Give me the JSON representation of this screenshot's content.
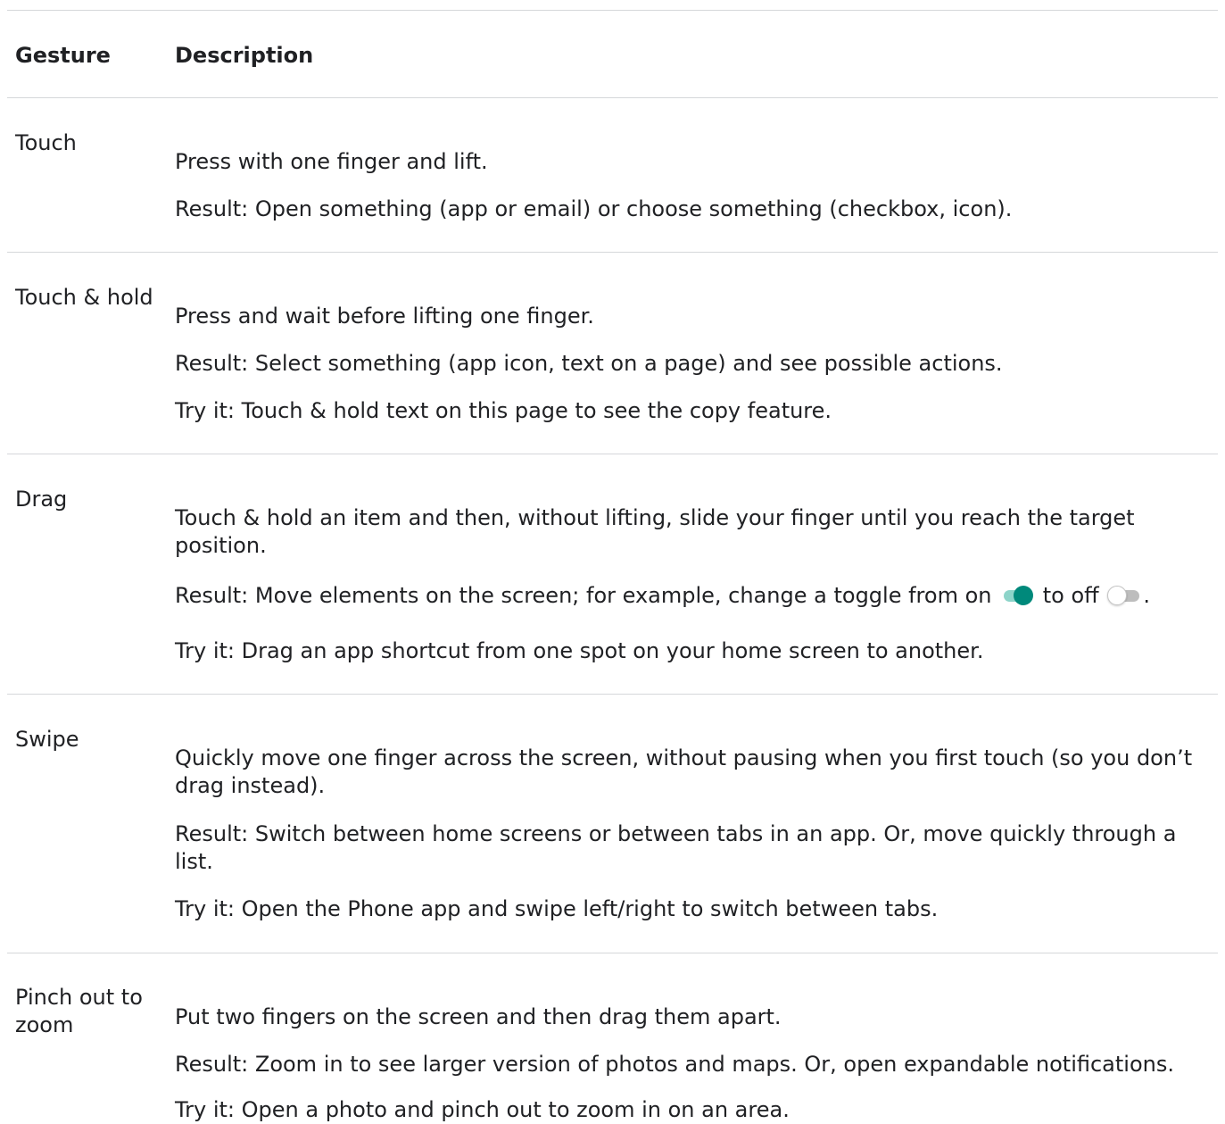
{
  "header": {
    "gesture": "Gesture",
    "description": "Description"
  },
  "rows": [
    {
      "gesture": "Touch",
      "lines": [
        "Press with one finger and lift.",
        "Result: Open something (app or email) or choose something (checkbox, icon)."
      ]
    },
    {
      "gesture": "Touch & hold",
      "lines": [
        "Press and wait before lifting one finger.",
        "Result: Select something (app icon, text on a page) and see possible actions.",
        "Try it: Touch & hold text on this page to see the copy feature."
      ]
    },
    {
      "gesture": "Drag",
      "lines": [
        "Touch & hold an item and then, without lifting, slide your finger until you reach the target position.",
        "Try it: Drag an app shortcut from one spot on your home screen to another."
      ],
      "result": {
        "prefix": "Result: Move elements on the screen; for example, change a toggle from on",
        "middle": "to off",
        "suffix": "."
      }
    },
    {
      "gesture": "Swipe",
      "lines": [
        "Quickly move one finger across the screen, without pausing when you first touch (so you don’t drag instead).",
        "Result: Switch between home screens or between tabs in an app. Or, move quickly through a list.",
        "Try it: Open the Phone app and swipe left/right to switch between tabs."
      ]
    },
    {
      "gesture": "Pinch out to zoom",
      "lines": [
        "Put two fingers on the screen and then drag them apart.",
        "Result: Zoom in to see larger version of photos and maps. Or, open expandable notifications.",
        "Try it: Open a photo and pinch out to zoom in on an area."
      ]
    }
  ],
  "colors": {
    "text": "#202124",
    "divider": "#d5d7da",
    "toggle_on_thumb": "#00897b",
    "toggle_on_track": "#8dd4c9",
    "toggle_off_track": "#bdbdbd"
  }
}
